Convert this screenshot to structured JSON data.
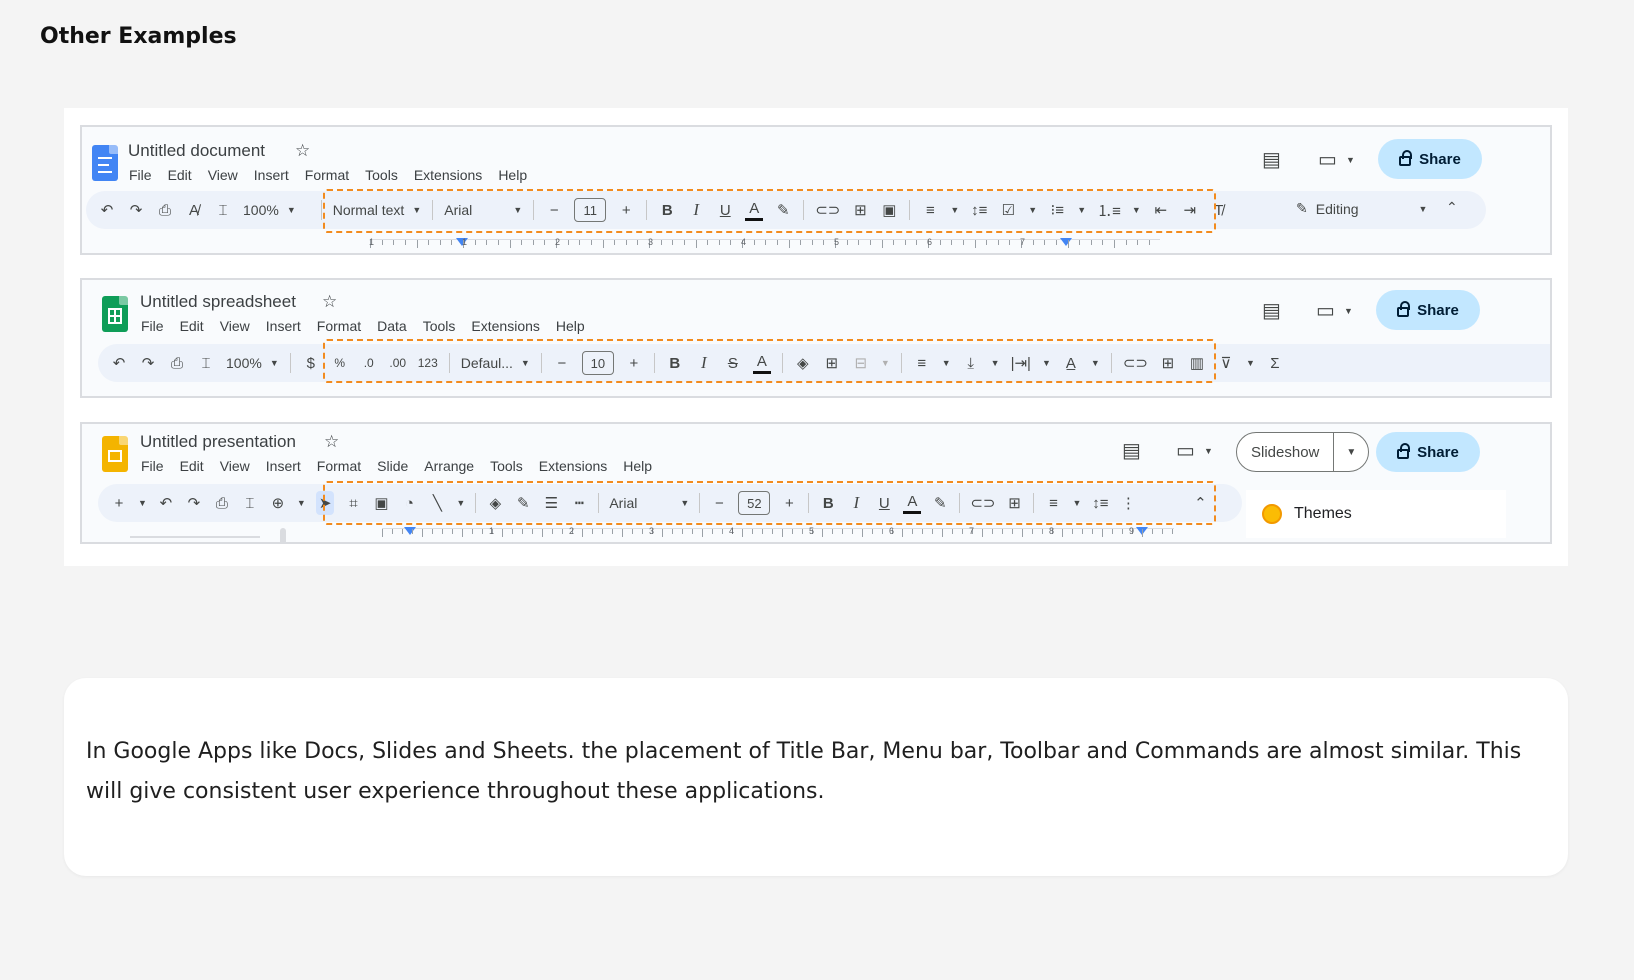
{
  "page_title": "Other Examples",
  "docs": {
    "title": "Untitled document",
    "menu": [
      "File",
      "Edit",
      "View",
      "Insert",
      "Format",
      "Tools",
      "Extensions",
      "Help"
    ],
    "zoom": "100%",
    "style": "Normal text",
    "font": "Arial",
    "font_size": "11",
    "mode": "Editing",
    "share_label": "Share",
    "ruler_numbers": [
      "1",
      "1",
      "2",
      "3",
      "4",
      "5",
      "6",
      "7"
    ]
  },
  "sheets": {
    "title": "Untitled spreadsheet",
    "menu": [
      "File",
      "Edit",
      "View",
      "Insert",
      "Format",
      "Data",
      "Tools",
      "Extensions",
      "Help"
    ],
    "zoom": "100%",
    "currency": "$",
    "percent": "%",
    "dec_decrease": ".0",
    "dec_increase": ".00",
    "number_format": "123",
    "font": "Defaul...",
    "font_size": "10",
    "share_label": "Share"
  },
  "slides": {
    "title": "Untitled presentation",
    "menu": [
      "File",
      "Edit",
      "View",
      "Insert",
      "Format",
      "Slide",
      "Arrange",
      "Tools",
      "Extensions",
      "Help"
    ],
    "font": "Arial",
    "font_size": "52",
    "slideshow_label": "Slideshow",
    "share_label": "Share",
    "themes_label": "Themes",
    "ruler_numbers": [
      "1",
      "2",
      "3",
      "4",
      "5",
      "6",
      "7",
      "8",
      "9"
    ]
  },
  "caption": "In Google Apps like Docs, Slides and Sheets. the placement of Title Bar, Menu bar, Toolbar and Commands are almost similar. This will give consistent user experience throughout these applications.",
  "colors": {
    "highlight": "#f28b1e",
    "share_bg": "#c2e7ff",
    "docs_blue": "#4285f4",
    "sheets_green": "#0f9d58",
    "slides_yellow": "#f4b400"
  }
}
